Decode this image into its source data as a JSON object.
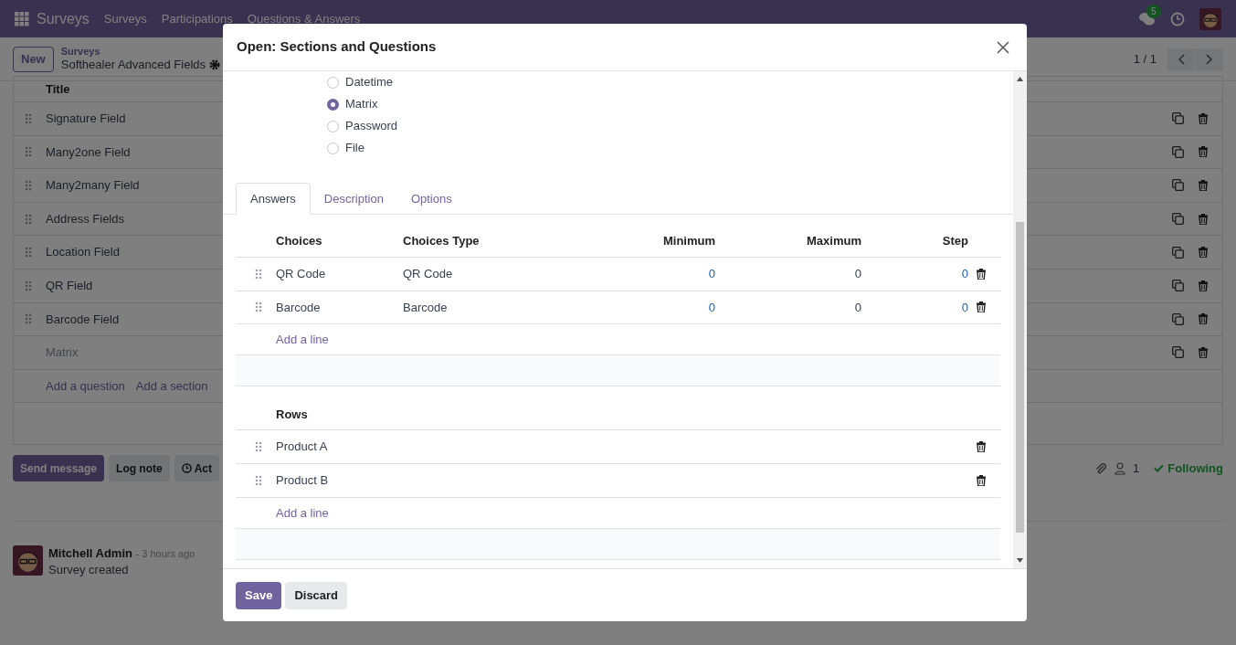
{
  "navbar": {
    "app": "Surveys",
    "menus": [
      "Surveys",
      "Participations",
      "Questions & Answers"
    ],
    "message_count": "5"
  },
  "control_panel": {
    "new_button": "New",
    "breadcrumb": "Surveys",
    "record": "Softhealer Advanced Fields",
    "pager": "1 / 1"
  },
  "questions": {
    "header": "Title",
    "rows": [
      {
        "title": "Signature Field",
        "kind": "saved"
      },
      {
        "title": "Many2one Field",
        "kind": "saved"
      },
      {
        "title": "Many2many Field",
        "kind": "saved"
      },
      {
        "title": "Address Fields",
        "kind": "saved"
      },
      {
        "title": "Location Field",
        "kind": "saved"
      },
      {
        "title": "QR Field",
        "kind": "saved"
      },
      {
        "title": "Barcode Field",
        "kind": "saved"
      },
      {
        "title": "Matrix",
        "kind": "draft"
      }
    ],
    "links": [
      "Add a question",
      "Add a section"
    ]
  },
  "chatter": {
    "buttons": [
      "Send message",
      "Log note",
      "Act"
    ],
    "followers": "1",
    "following": "Following"
  },
  "message": {
    "author": "Mitchell Admin",
    "time": "- 3 hours ago",
    "body": "Survey created"
  },
  "dialog": {
    "title": "Open: Sections and Questions",
    "question_types": [
      {
        "label": "Datetime",
        "selected": false
      },
      {
        "label": "Matrix",
        "selected": true
      },
      {
        "label": "Password",
        "selected": false
      },
      {
        "label": "File",
        "selected": false
      }
    ],
    "tabs": [
      {
        "label": "Answers",
        "selected": true
      },
      {
        "label": "Description",
        "selected": false
      },
      {
        "label": "Options",
        "selected": false
      }
    ],
    "choices": {
      "columns": [
        "Choices",
        "Choices Type",
        "Minimum",
        "Maximum",
        "Step"
      ],
      "rows": [
        {
          "choice": "QR Code",
          "type": "QR Code",
          "minimum": "0",
          "maximum": "0",
          "step": "0"
        },
        {
          "choice": "Barcode",
          "type": "Barcode",
          "minimum": "0",
          "maximum": "0",
          "step": "0"
        }
      ],
      "add_line": "Add a line"
    },
    "rows": {
      "column": "Rows",
      "rows": [
        "Product A",
        "Product B"
      ],
      "add_line": "Add a line"
    },
    "buttons": [
      "Save",
      "Discard"
    ]
  }
}
